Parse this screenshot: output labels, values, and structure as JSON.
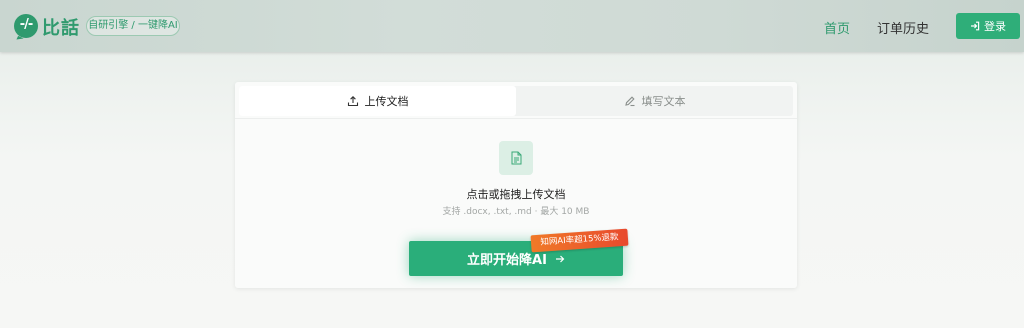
{
  "header": {
    "logo_glyph": "-/-",
    "logo_text": "比話",
    "badge": "自研引擎 / 一键降AI",
    "nav": {
      "home": "首页",
      "orders": "订单历史"
    },
    "login_label": "登录"
  },
  "card": {
    "tabs": {
      "upload": "上传文档",
      "text": "填写文本"
    },
    "upload_title": "点击或拖拽上传文档",
    "upload_hint": "支持 .docx, .txt, .md · 最大 10 MB",
    "start_button": "立即开始降AI",
    "promo_tag": "知网AI率超15%退款"
  },
  "colors": {
    "brand": "#2f9a6e",
    "button": "#2aae7a",
    "promo": "#ee6a2a"
  },
  "icons": {
    "logo": "chat-bubble-logo-icon",
    "login": "login-arrow-icon",
    "upload_tab": "upload-icon",
    "text_tab": "pencil-icon",
    "file": "document-icon",
    "start": "arrow-right-icon"
  }
}
